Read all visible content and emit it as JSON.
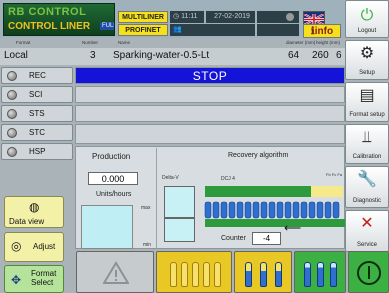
{
  "header": {
    "logo_line1": "RB CONTROL",
    "logo_line2": "CONTROL LINER",
    "logo_tag": "FULL",
    "mode_top": "MULTILINER",
    "mode_bottom": "PROFINET",
    "time": "11:11",
    "date": "27-02-2019",
    "info_label": "info",
    "columns": [
      "Format",
      "Number",
      "Name",
      "diameter (mm)",
      "height (mm)",
      "file"
    ]
  },
  "product": {
    "format": "Local",
    "number": "3",
    "name": "Sparking-water-0.5-Lt",
    "diameter": "64",
    "height": "260",
    "file": "6"
  },
  "nav": [
    {
      "label": "REC"
    },
    {
      "label": "SCI"
    },
    {
      "label": "STS"
    },
    {
      "label": "STC"
    },
    {
      "label": "HSP"
    }
  ],
  "status": {
    "main": "STOP"
  },
  "production": {
    "title": "Production",
    "value": "0.000",
    "unit": "Units/hours",
    "max_label": "max",
    "min_label": "min"
  },
  "recovery": {
    "title": "Recovery algorithm",
    "delta_label": "Delta-V",
    "dcj_label": "DCJ",
    "dcj_value": "4",
    "flags": "Fb Fc Fa",
    "counter_label": "Counter",
    "counter_value": "-4"
  },
  "right_menu": [
    {
      "label": "Logout",
      "icon": "power-icon"
    },
    {
      "label": "Setup",
      "icon": "gear-icon"
    },
    {
      "label": "Format setup",
      "icon": "format-icon"
    },
    {
      "label": "Calibration",
      "icon": "calibration-icon"
    },
    {
      "label": "Diagnostic",
      "icon": "diagnostic-icon"
    },
    {
      "label": "Service",
      "icon": "service-icon"
    }
  ],
  "left_menu": [
    {
      "label": "Data view",
      "icon": "gauge-icon"
    },
    {
      "label": "Adjust",
      "icon": "adjust-icon"
    },
    {
      "label": "Format Select",
      "icon": "format-select-icon"
    }
  ],
  "colors": {
    "stop_blue": "#1414d8",
    "yellow": "#f4e01b",
    "green": "#3cb043",
    "conveyor_green": "#2d9a3e",
    "bottle_blue": "#2e6fd0"
  }
}
